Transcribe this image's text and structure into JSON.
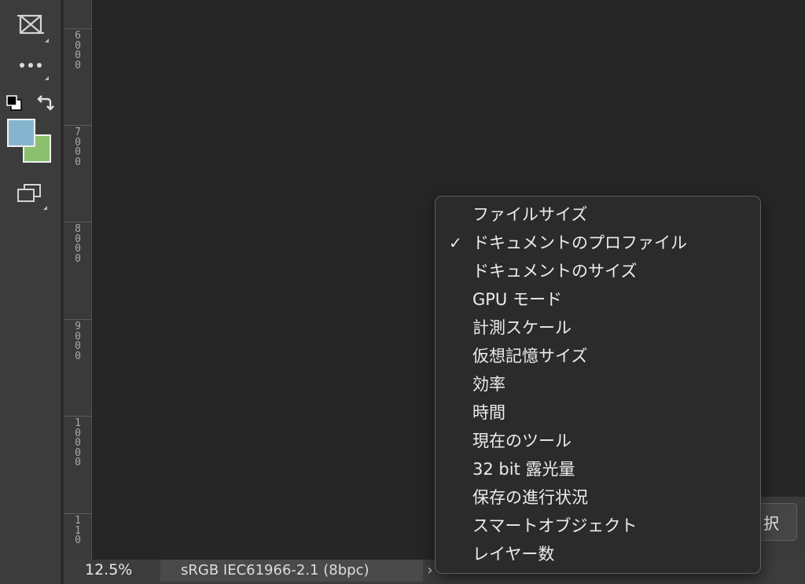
{
  "toolbar": {
    "tools": [
      {
        "name": "frame-tool",
        "icon": "frame-icon"
      },
      {
        "name": "more-tools",
        "icon": "ellipsis-icon"
      },
      {
        "name": "default-colors",
        "icon": "default-colors-icon"
      },
      {
        "name": "swap-colors",
        "icon": "swap-arrow-icon"
      },
      {
        "name": "screen-mode",
        "icon": "screen-mode-icon"
      }
    ],
    "foreground_color": "#86b6cf",
    "background_color": "#8ac06e"
  },
  "ruler": {
    "labels": [
      "6\n0\n0\n0",
      "7\n0\n0\n0",
      "8\n0\n0\n0",
      "9\n0\n0\n0",
      "1\n0\n0\n0\n0",
      "1\n1\n0"
    ]
  },
  "status": {
    "zoom": "12.5%",
    "profile": "sRGB IEC61966-2.1 (8bpc)",
    "arrow": "›"
  },
  "panel": {
    "button_label": "択"
  },
  "menu": {
    "checkmark": "✓",
    "items": [
      {
        "label": "ファイルサイズ",
        "checked": false
      },
      {
        "label": "ドキュメントのプロファイル",
        "checked": true
      },
      {
        "label": "ドキュメントのサイズ",
        "checked": false
      },
      {
        "label": "GPU モード",
        "checked": false
      },
      {
        "label": "計測スケール",
        "checked": false
      },
      {
        "label": "仮想記憶サイズ",
        "checked": false
      },
      {
        "label": "効率",
        "checked": false
      },
      {
        "label": "時間",
        "checked": false
      },
      {
        "label": "現在のツール",
        "checked": false
      },
      {
        "label": "32 bit 露光量",
        "checked": false
      },
      {
        "label": "保存の進行状況",
        "checked": false
      },
      {
        "label": "スマートオブジェクト",
        "checked": false
      },
      {
        "label": "レイヤー数",
        "checked": false
      }
    ]
  }
}
